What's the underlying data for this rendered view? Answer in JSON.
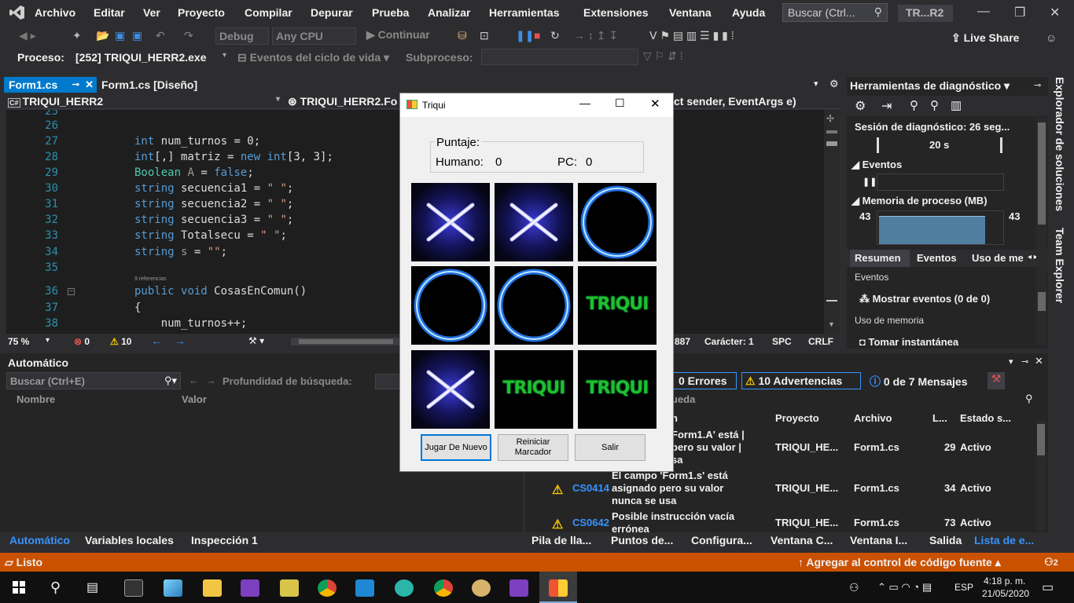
{
  "menu": [
    "Archivo",
    "Editar",
    "Ver",
    "Proyecto",
    "Compilar",
    "Depurar",
    "Prueba",
    "Analizar",
    "Herramientas",
    "Extensiones",
    "Ventana",
    "Ayuda"
  ],
  "search_placeholder": "Buscar (Ctrl...",
  "solution_name": "TR...R2",
  "toolbar": {
    "config": "Debug",
    "platform": "Any CPU",
    "continue": "Continuar",
    "live_share": "Live Share"
  },
  "process_bar": {
    "label": "Proceso:",
    "process": "[252] TRIQUI_HERR2.exe",
    "events": "Eventos del ciclo de vida",
    "thread": "Subproceso:"
  },
  "tabs": [
    "Form1.cs",
    "Form1.cs [Diseño]"
  ],
  "nav": {
    "project": "TRIQUI_HERR2",
    "class": "TRIQUI_HERR2.Fo",
    "method": "ct sender, EventArgs e)"
  },
  "code": {
    "lines": [
      "25",
      "26",
      "27",
      "28",
      "29",
      "30",
      "31",
      "32",
      "33",
      "34",
      "35",
      "36",
      "37",
      "38"
    ],
    "refs": "9 referencias"
  },
  "editor_status": {
    "zoom": "75 %",
    "errors": "0",
    "warnings": "10",
    "col": "887",
    "char": "Carácter: 1",
    "spc": "SPC",
    "crlf": "CRLF"
  },
  "diagnostics": {
    "title": "Herramientas de diagnóstico",
    "session": "Sesión de diagnóstico: 26 seg...",
    "timeline": "20 s",
    "events": "Eventos",
    "memory": "Memoria de proceso (MB)",
    "mem_min": "43",
    "mem_max": "43",
    "tabs": [
      "Resumen",
      "Eventos",
      "Uso de me"
    ],
    "events_section": "Eventos",
    "show_events": "Mostrar eventos (0 de 0)",
    "memory_section": "Uso de memoria",
    "snapshot": "Tomar instantánea"
  },
  "side_tabs": [
    "Explorador de soluciones",
    "Team Explorer"
  ],
  "autos": {
    "title": "Automático",
    "search": "Buscar (Ctrl+E)",
    "depth": "Profundidad de búsqueda:",
    "columns": [
      "Nombre",
      "Valor"
    ],
    "tabs": [
      "Automático",
      "Variables locales",
      "Inspección 1"
    ]
  },
  "errors": {
    "errors": "0 Errores",
    "warnings": "10 Advertencias",
    "messages": "0 de 7 Mensajes",
    "search_fragment": "ueda",
    "columns": [
      "n",
      "Proyecto",
      "Archivo",
      "L...",
      "Estado s..."
    ],
    "rows": [
      {
        "code": "",
        "desc": "Form1.A' está | pero su valor | sa",
        "project": "TRIQUI_HE...",
        "file": "Form1.cs",
        "line": "29",
        "state": "Activo"
      },
      {
        "code": "CS0414",
        "desc": "El campo 'Form1.s' está asignado pero su valor nunca se usa",
        "project": "TRIQUI_HE...",
        "file": "Form1.cs",
        "line": "34",
        "state": "Activo"
      },
      {
        "code": "CS0642",
        "desc": "Posible instrucción vacía errónea",
        "project": "TRIQUI_HE...",
        "file": "Form1.cs",
        "line": "73",
        "state": "Activo"
      }
    ],
    "tabs": [
      "Pila de lla...",
      "Puntos de...",
      "Configura...",
      "Ventana C...",
      "Ventana I...",
      "Salida",
      "Lista de e..."
    ]
  },
  "statusbar": {
    "ready": "Listo",
    "source": "Agregar al control de código fuente",
    "notif": "2"
  },
  "taskbar": {
    "lang": "ESP",
    "time": "4:18 p. m.",
    "date": "21/05/2020"
  },
  "dialog": {
    "title": "Triqui",
    "score_label": "Puntaje:",
    "human_label": "Humano:",
    "human_score": "0",
    "pc_label": "PC:",
    "pc_score": "0",
    "board": [
      "X",
      "X",
      "O",
      "O",
      "O",
      "TRIQUI",
      "X",
      "TRIQUI",
      "TRIQUI"
    ],
    "triqui_text": "TRIQUI",
    "buttons": [
      "Jugar De Nuevo",
      "Reiniciar Marcador",
      "Salir"
    ]
  }
}
